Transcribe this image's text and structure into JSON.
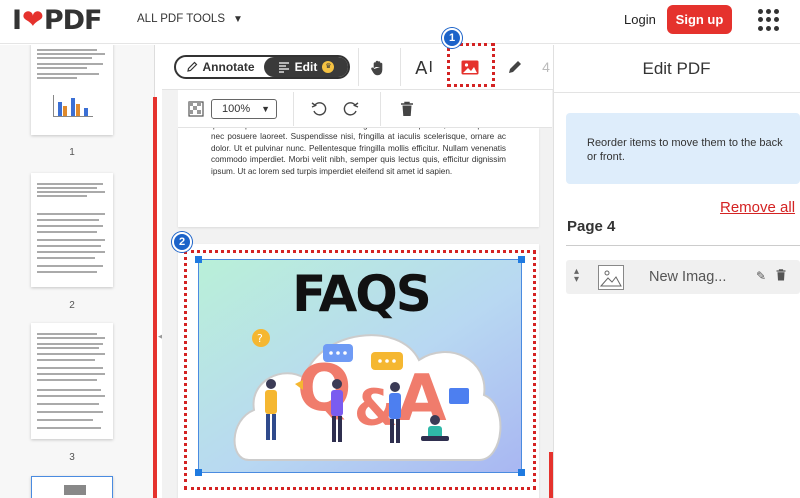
{
  "header": {
    "logo_left": "I",
    "logo_right": "PDF",
    "tools_menu": "ALL PDF TOOLS",
    "login": "Login",
    "signup": "Sign up"
  },
  "thumbnails": [
    {
      "page": "1"
    },
    {
      "page": "2"
    },
    {
      "page": "3"
    }
  ],
  "toolbar": {
    "annotate_label": "Annotate",
    "edit_label": "Edit",
    "text_tool_glyph": "A",
    "zoom_value": "100%"
  },
  "badges": {
    "one": "1",
    "two": "2"
  },
  "page_text": "ipsum sapien in lectus sodales viverra eget a dolor. Imperdiet, erat at pulvinar nec posuere laoreet. Suspendisse nisi, fringilla at iaculis scelerisque, ornare ac dolor. Ut et pulvinar nunc. Pellentesque fringilla mollis efficitur. Nullam venenatis commodo imperdiet. Morbi velit nibh, semper quis lectus quis, efficitur dignissim ipsum. Ut ac lorem sed turpis imperdiet eleifend sit amet id sapien.",
  "image": {
    "headline": "FAQS"
  },
  "right_panel": {
    "title": "Edit PDF",
    "info": "Reorder items to move them to the back or front.",
    "remove_all": "Remove all",
    "page_label": "Page 4",
    "layers": [
      {
        "name": "New Imag..."
      }
    ]
  },
  "colors": {
    "brand_red": "#e5322d",
    "badge_blue": "#1c63c9",
    "info_bg": "#deedfb"
  }
}
